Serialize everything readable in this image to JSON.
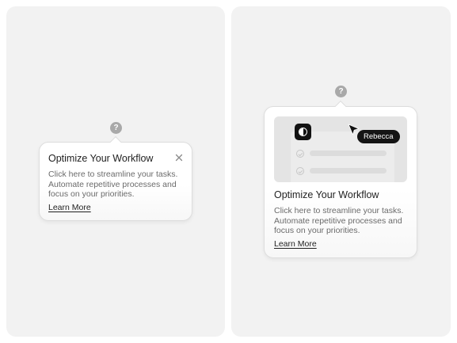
{
  "help_glyph": "?",
  "tooltip_compact": {
    "title": "Optimize Your Workflow",
    "body": "Click here to streamline your tasks. Automate repetitive processes and focus on your priorities.",
    "link": "Learn More",
    "close_icon": "close-icon"
  },
  "tooltip_rich": {
    "title": "Optimize Your Workflow",
    "body": "Click here to streamline your tasks. Automate repetitive processes and focus on your priorities.",
    "link": "Learn More",
    "preview": {
      "app_icon": "contrast-icon",
      "cursor_icon": "pointer-cursor-icon",
      "user_tag": "Rebecca",
      "checklist_icon": "check-circle-icon"
    }
  },
  "colors": {
    "panel_bg": "#f2f2f2",
    "help_icon": "#a9a9a9",
    "title_text": "#1f1f1f",
    "body_text": "#6b6b6b",
    "tag_bg": "#141414"
  }
}
